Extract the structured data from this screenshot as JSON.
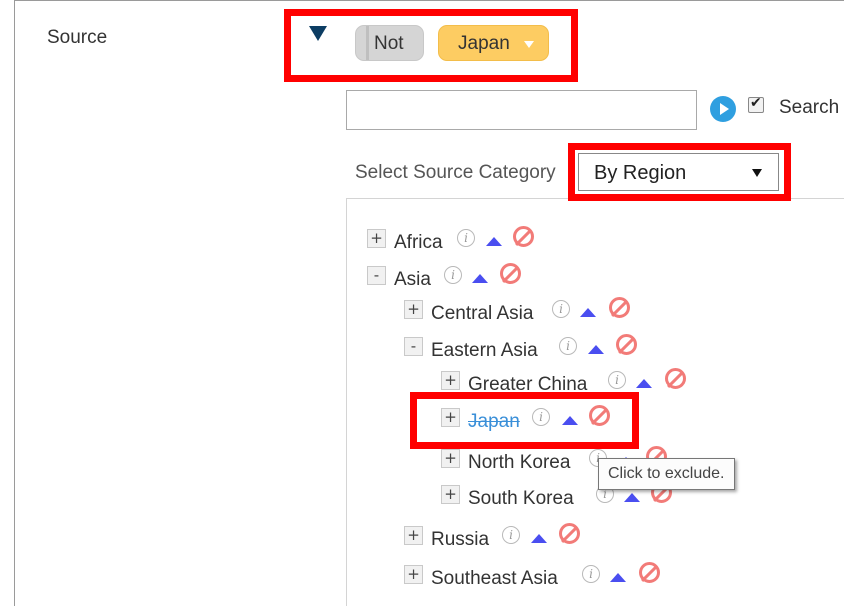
{
  "filter": {
    "section_label": "Source",
    "not_label": "Not",
    "value_label": "Japan"
  },
  "search": {
    "input_value": "",
    "checkbox_label": "Search",
    "checkbox_checked": true
  },
  "category": {
    "label": "Select Source Category",
    "selected": "By Region"
  },
  "tree": {
    "nodes": [
      {
        "label": "Africa",
        "toggle": "+"
      },
      {
        "label": "Asia",
        "toggle": "-"
      },
      {
        "label": "Central Asia",
        "toggle": "+"
      },
      {
        "label": "Eastern Asia",
        "toggle": "-"
      },
      {
        "label": "Greater China",
        "toggle": "+"
      },
      {
        "label": "Japan",
        "toggle": "+",
        "excluded": true
      },
      {
        "label": "North Korea",
        "toggle": "+"
      },
      {
        "label": "South Korea",
        "toggle": "+"
      },
      {
        "label": "Russia",
        "toggle": "+"
      },
      {
        "label": "Southeast Asia",
        "toggle": "+"
      }
    ]
  },
  "tooltip": {
    "text": "Click to exclude."
  },
  "colors": {
    "highlight": "#ff0000",
    "not_pill": "#d5d5d5",
    "value_pill": "#fdcc62",
    "excluded_link": "#3a8fd8",
    "up_arrow": "#4a4ef0",
    "exclude_icon": "#f27b78",
    "go_button": "#2f9fe0",
    "collapse_arrow": "#0c3d63"
  },
  "icons": {
    "info": "info-icon",
    "move_up": "arrow-up-icon",
    "exclude": "ban-icon",
    "go": "play-circle-icon",
    "collapse": "triangle-down-icon"
  }
}
